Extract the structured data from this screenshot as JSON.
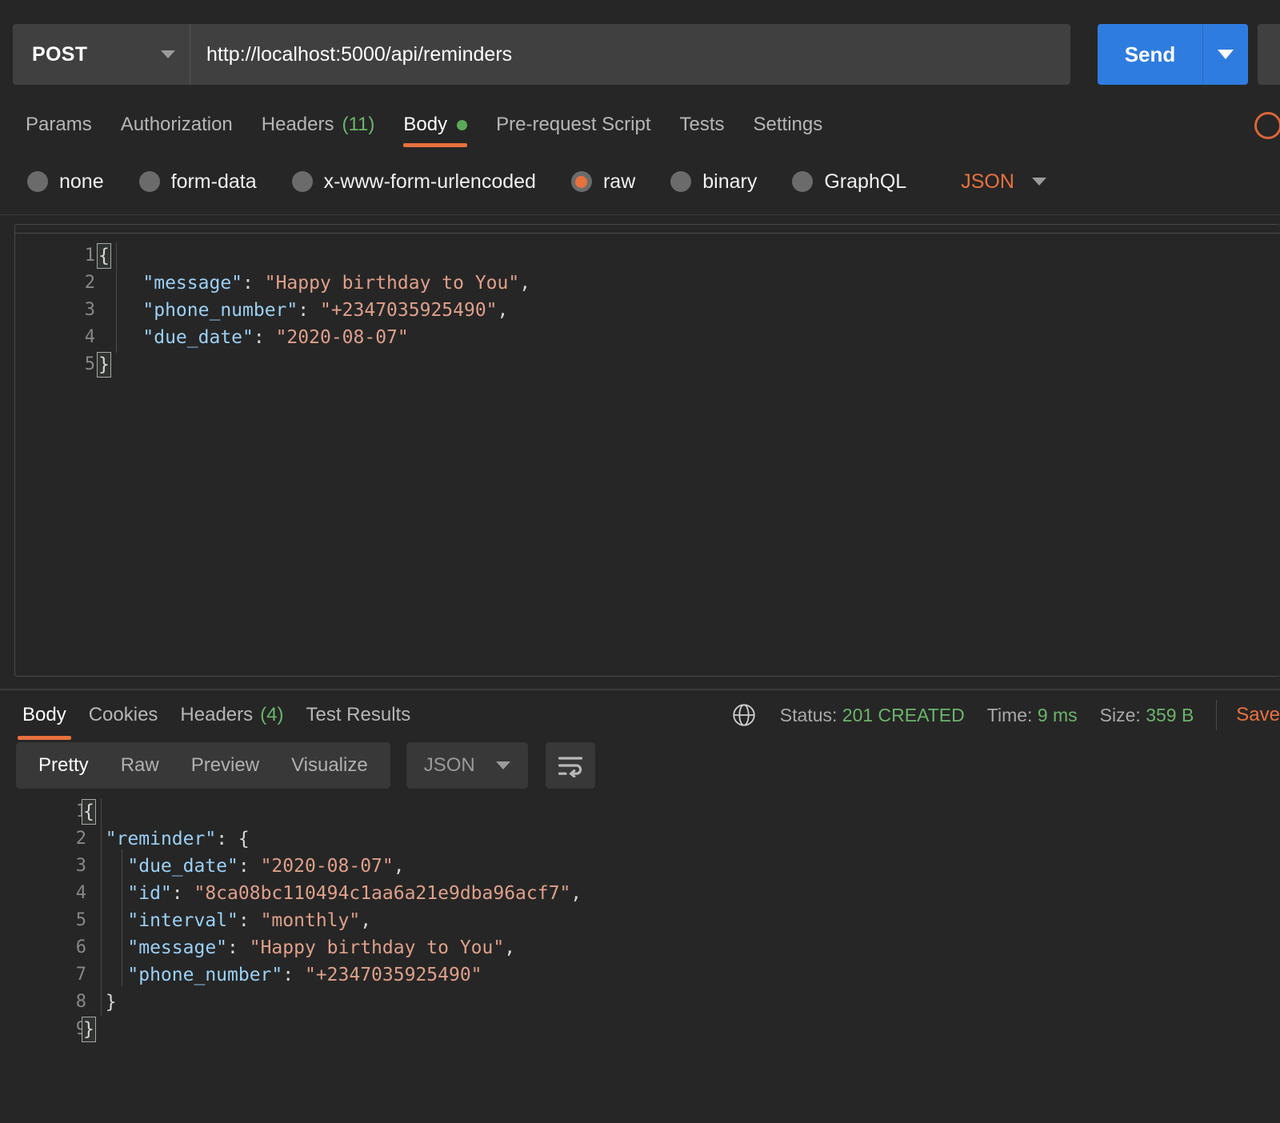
{
  "request": {
    "method": "POST",
    "url": "http://localhost:5000/api/reminders",
    "send_label": "Send",
    "tabs": [
      {
        "label": "Params",
        "count": "",
        "active": false,
        "dot": false
      },
      {
        "label": "Authorization",
        "count": "",
        "active": false,
        "dot": false
      },
      {
        "label": "Headers",
        "count": "(11)",
        "active": false,
        "dot": false
      },
      {
        "label": "Body",
        "count": "",
        "active": true,
        "dot": true
      },
      {
        "label": "Pre-request Script",
        "count": "",
        "active": false,
        "dot": false
      },
      {
        "label": "Tests",
        "count": "",
        "active": false,
        "dot": false
      },
      {
        "label": "Settings",
        "count": "",
        "active": false,
        "dot": false
      }
    ],
    "body_types": [
      {
        "label": "none",
        "selected": false
      },
      {
        "label": "form-data",
        "selected": false
      },
      {
        "label": "x-www-form-urlencoded",
        "selected": false
      },
      {
        "label": "raw",
        "selected": true
      },
      {
        "label": "binary",
        "selected": false
      },
      {
        "label": "GraphQL",
        "selected": false
      }
    ],
    "raw_format": "JSON",
    "body_code": [
      {
        "num": "1",
        "segments": [
          {
            "t": "{",
            "c": "brace"
          }
        ]
      },
      {
        "num": "2",
        "segments": [
          {
            "t": "    ",
            "c": "p"
          },
          {
            "t": "\"message\"",
            "c": "k"
          },
          {
            "t": ": ",
            "c": "p"
          },
          {
            "t": "\"Happy birthday to You\"",
            "c": "s"
          },
          {
            "t": ",",
            "c": "p"
          }
        ]
      },
      {
        "num": "3",
        "segments": [
          {
            "t": "    ",
            "c": "p"
          },
          {
            "t": "\"phone_number\"",
            "c": "k"
          },
          {
            "t": ": ",
            "c": "p"
          },
          {
            "t": "\"+2347035925490\"",
            "c": "s"
          },
          {
            "t": ",",
            "c": "p"
          }
        ]
      },
      {
        "num": "4",
        "segments": [
          {
            "t": "    ",
            "c": "p"
          },
          {
            "t": "\"due_date\"",
            "c": "k"
          },
          {
            "t": ": ",
            "c": "p"
          },
          {
            "t": "\"2020-08-07\"",
            "c": "s"
          }
        ]
      },
      {
        "num": "5",
        "segments": [
          {
            "t": "}",
            "c": "brace"
          }
        ]
      }
    ]
  },
  "response": {
    "tabs": [
      {
        "label": "Body",
        "count": "",
        "active": true
      },
      {
        "label": "Cookies",
        "count": "",
        "active": false
      },
      {
        "label": "Headers",
        "count": "(4)",
        "active": false
      },
      {
        "label": "Test Results",
        "count": "",
        "active": false
      }
    ],
    "meta": {
      "status_label": "Status:",
      "status_value": "201 CREATED",
      "time_label": "Time:",
      "time_value": "9 ms",
      "size_label": "Size:",
      "size_value": "359 B",
      "save_label": "Save"
    },
    "view_tabs": [
      {
        "label": "Pretty",
        "active": true
      },
      {
        "label": "Raw",
        "active": false
      },
      {
        "label": "Preview",
        "active": false
      },
      {
        "label": "Visualize",
        "active": false
      }
    ],
    "format": "JSON",
    "body_code": [
      {
        "num": "1",
        "segments": [
          {
            "t": "{",
            "c": "brace"
          }
        ]
      },
      {
        "num": "2",
        "segments": [
          {
            "t": "  ",
            "c": "p"
          },
          {
            "t": "\"reminder\"",
            "c": "k"
          },
          {
            "t": ": {",
            "c": "p"
          }
        ]
      },
      {
        "num": "3",
        "segments": [
          {
            "t": "    ",
            "c": "p"
          },
          {
            "t": "\"due_date\"",
            "c": "k"
          },
          {
            "t": ": ",
            "c": "p"
          },
          {
            "t": "\"2020-08-07\"",
            "c": "s"
          },
          {
            "t": ",",
            "c": "p"
          }
        ]
      },
      {
        "num": "4",
        "segments": [
          {
            "t": "    ",
            "c": "p"
          },
          {
            "t": "\"id\"",
            "c": "k"
          },
          {
            "t": ": ",
            "c": "p"
          },
          {
            "t": "\"8ca08bc110494c1aa6a21e9dba96acf7\"",
            "c": "s"
          },
          {
            "t": ",",
            "c": "p"
          }
        ]
      },
      {
        "num": "5",
        "segments": [
          {
            "t": "    ",
            "c": "p"
          },
          {
            "t": "\"interval\"",
            "c": "k"
          },
          {
            "t": ": ",
            "c": "p"
          },
          {
            "t": "\"monthly\"",
            "c": "s"
          },
          {
            "t": ",",
            "c": "p"
          }
        ]
      },
      {
        "num": "6",
        "segments": [
          {
            "t": "    ",
            "c": "p"
          },
          {
            "t": "\"message\"",
            "c": "k"
          },
          {
            "t": ": ",
            "c": "p"
          },
          {
            "t": "\"Happy birthday to You\"",
            "c": "s"
          },
          {
            "t": ",",
            "c": "p"
          }
        ]
      },
      {
        "num": "7",
        "segments": [
          {
            "t": "    ",
            "c": "p"
          },
          {
            "t": "\"phone_number\"",
            "c": "k"
          },
          {
            "t": ": ",
            "c": "p"
          },
          {
            "t": "\"+2347035925490\"",
            "c": "s"
          }
        ]
      },
      {
        "num": "8",
        "segments": [
          {
            "t": "  }",
            "c": "p"
          }
        ]
      },
      {
        "num": "9",
        "segments": [
          {
            "t": "}",
            "c": "brace"
          }
        ]
      }
    ]
  },
  "colors": {
    "background": "#262626",
    "accent_orange": "#e8713e",
    "send_blue": "#2f7ce0",
    "status_green": "#6bb56b",
    "json_key_blue": "#9bd0f5",
    "json_string": "#dfa08a"
  },
  "icons": {
    "method_caret": "chevron-down-icon",
    "send_caret": "chevron-down-icon",
    "globe": "globe-icon",
    "wrap": "wrap-lines-icon"
  }
}
